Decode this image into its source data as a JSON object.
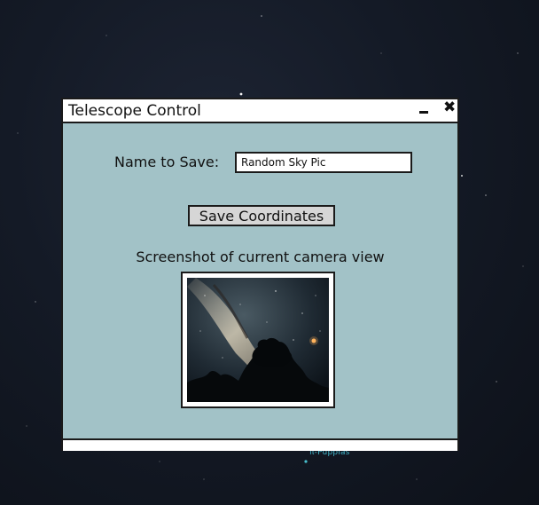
{
  "window": {
    "title": "Telescope Control",
    "minimize_icon": "minimize-icon",
    "close_icon": "close-icon",
    "close_glyph": "✖"
  },
  "form": {
    "name_label": "Name to Save:",
    "name_value": "Random Sky Pic",
    "save_button_label": "Save Coordinates"
  },
  "preview": {
    "caption": "Screenshot of current camera view"
  },
  "background": {
    "star_label": "π-Puppias"
  },
  "colors": {
    "window_bg": "#a2c2c7",
    "titlebar_bg": "#ffffff",
    "button_bg": "#d6d6d6",
    "sky_bg": "#141a26"
  }
}
